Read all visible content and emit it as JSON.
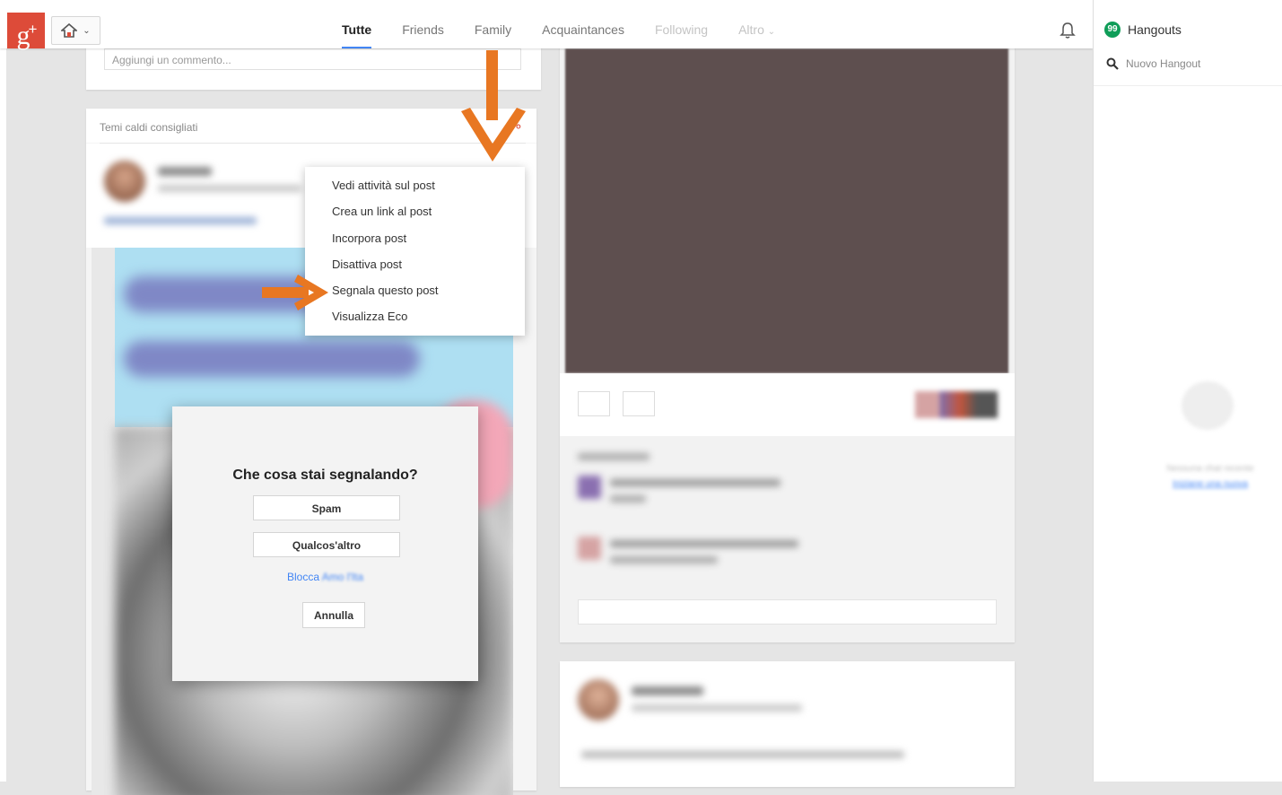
{
  "header": {
    "logo_text": "g",
    "logo_plus": "+",
    "tabs": [
      {
        "label": "Tutte",
        "active": true
      },
      {
        "label": "Friends"
      },
      {
        "label": "Family"
      },
      {
        "label": "Acquaintances"
      },
      {
        "label": "Following"
      },
      {
        "label": "Altro"
      }
    ]
  },
  "left_column": {
    "comment_placeholder": "Aggiungi un commento...",
    "hot_topics_label": "Temi caldi consigliati"
  },
  "post_menu": {
    "items": [
      "Vedi attività sul post",
      "Crea un link al post",
      "Incorpora post",
      "Disattiva post",
      "Segnala questo post",
      "Visualizza Eco"
    ]
  },
  "report_dialog": {
    "title": "Che cosa stai segnalando?",
    "spam_label": "Spam",
    "other_label": "Qualcos'altro",
    "block_link_prefix": "Blocca",
    "block_link_blurred": "Amo l'Ita",
    "cancel_label": "Annulla"
  },
  "hangouts": {
    "title": "Hangouts",
    "new_hangout_placeholder": "Nuovo Hangout",
    "badge_text": "99",
    "empty_text": "Nessuna chat recente",
    "empty_link": "Iniziane una nuova"
  },
  "colors": {
    "brand_red": "#dd4b39",
    "accent_blue": "#4285f4",
    "annotation_orange": "#e87722",
    "hangouts_green": "#0f9d58"
  }
}
